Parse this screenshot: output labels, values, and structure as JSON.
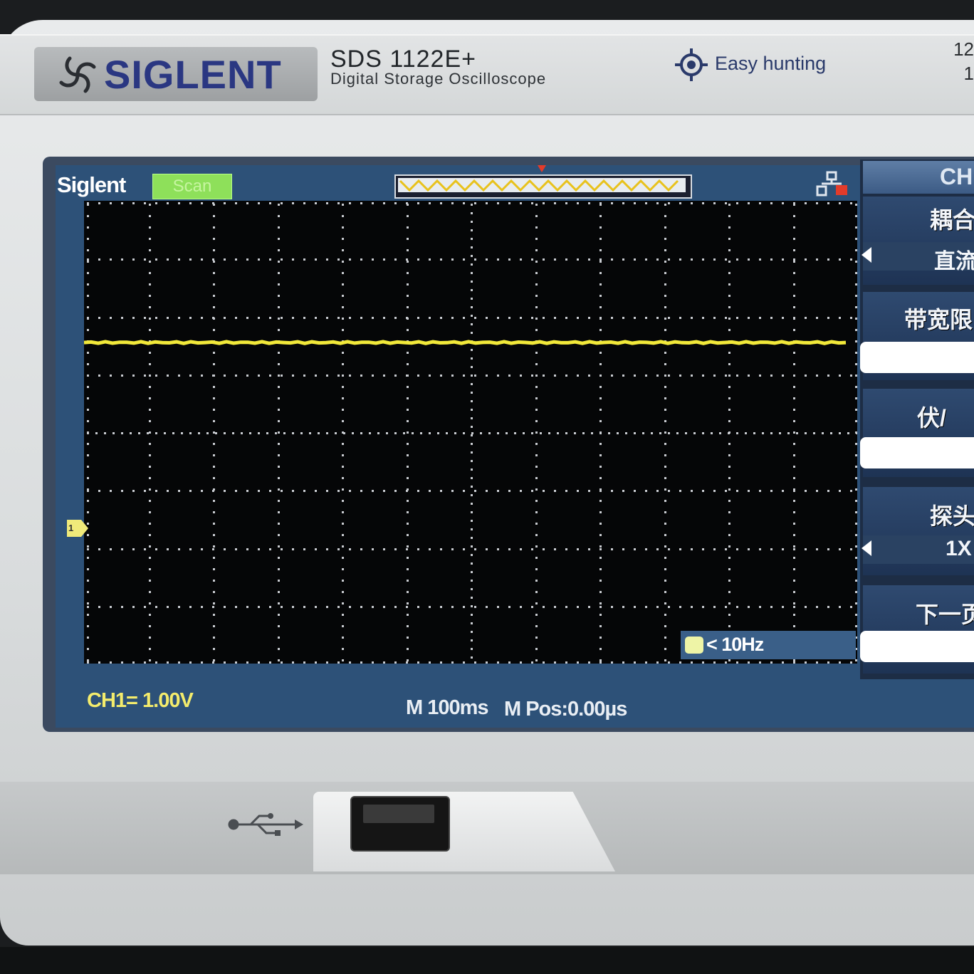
{
  "device": {
    "brand_logo": "SIGLENT",
    "model": "SDS 1122E+",
    "description": "Digital Storage Oscilloscope",
    "feature_text": "Easy hunting",
    "corner_top": "12",
    "corner_bottom": "1"
  },
  "screen": {
    "brand": "Siglent",
    "run_status": "Scan",
    "trigger_frequency": "< 10Hz",
    "channel_marker": "1",
    "ch1_scale": "CH1= 1.00V",
    "timebase": "M 100ms",
    "mpos": "M Pos:0.00µs"
  },
  "menu": {
    "title": "CH",
    "items": [
      {
        "label": "耦合",
        "value": "直流"
      },
      {
        "label": "带宽限",
        "value": ""
      },
      {
        "label": "伏/",
        "value": ""
      },
      {
        "label": "探头",
        "value": "1X"
      },
      {
        "label": "下一页",
        "value": ""
      }
    ]
  },
  "colors": {
    "trace": "#f2e93a",
    "screen_bg": "#2d5178",
    "grid_dot": "#c9ccd1",
    "run_status_bg": "#8ee05a",
    "scale_text": "#f4ec6c"
  },
  "icons": {
    "usb": "usb-icon",
    "easy": "crosshair-icon",
    "connection": "network-icon"
  }
}
